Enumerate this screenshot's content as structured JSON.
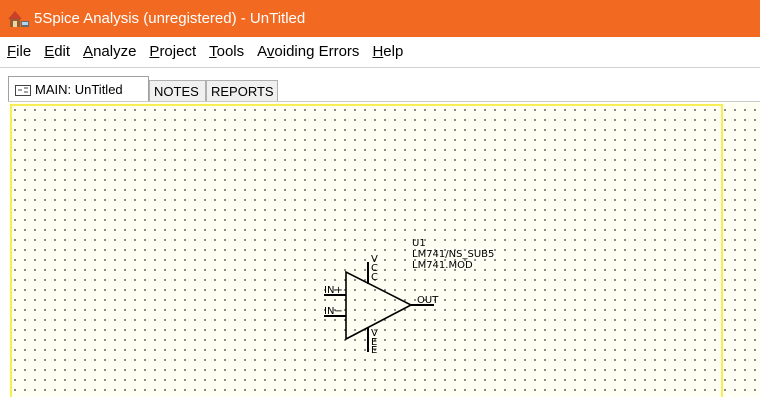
{
  "window": {
    "title": "5Spice Analysis (unregistered) - UnTitled"
  },
  "menu": {
    "items": [
      {
        "key": "F",
        "rest": "ile"
      },
      {
        "key": "E",
        "rest": "dit"
      },
      {
        "key": "A",
        "rest": "nalyze"
      },
      {
        "key": "P",
        "rest": "roject"
      },
      {
        "key": "T",
        "rest": "ools"
      },
      {
        "pre": "A",
        "key": "v",
        "rest": "oiding Errors"
      },
      {
        "key": "H",
        "rest": "elp"
      }
    ]
  },
  "tabs": [
    {
      "label": "MAIN: UnTitled",
      "active": true
    },
    {
      "label": "NOTES",
      "active": false
    },
    {
      "label": "REPORTS",
      "active": false
    }
  ],
  "component": {
    "ref": "U1",
    "model": "LM741/NS_SUB5",
    "file": "LM741.MOD",
    "pins": {
      "in_plus": "IN+",
      "in_minus": "IN−",
      "out": "OUT",
      "vcc": "V",
      "vcc_sub": "C",
      "vcc_sub2": "C",
      "vee": "V",
      "vee_sub": "E",
      "vee_sub2": "E"
    }
  },
  "colors": {
    "titlebar": "#f26a22",
    "canvas": "#fffff4",
    "page_border": "#f6ee52"
  }
}
